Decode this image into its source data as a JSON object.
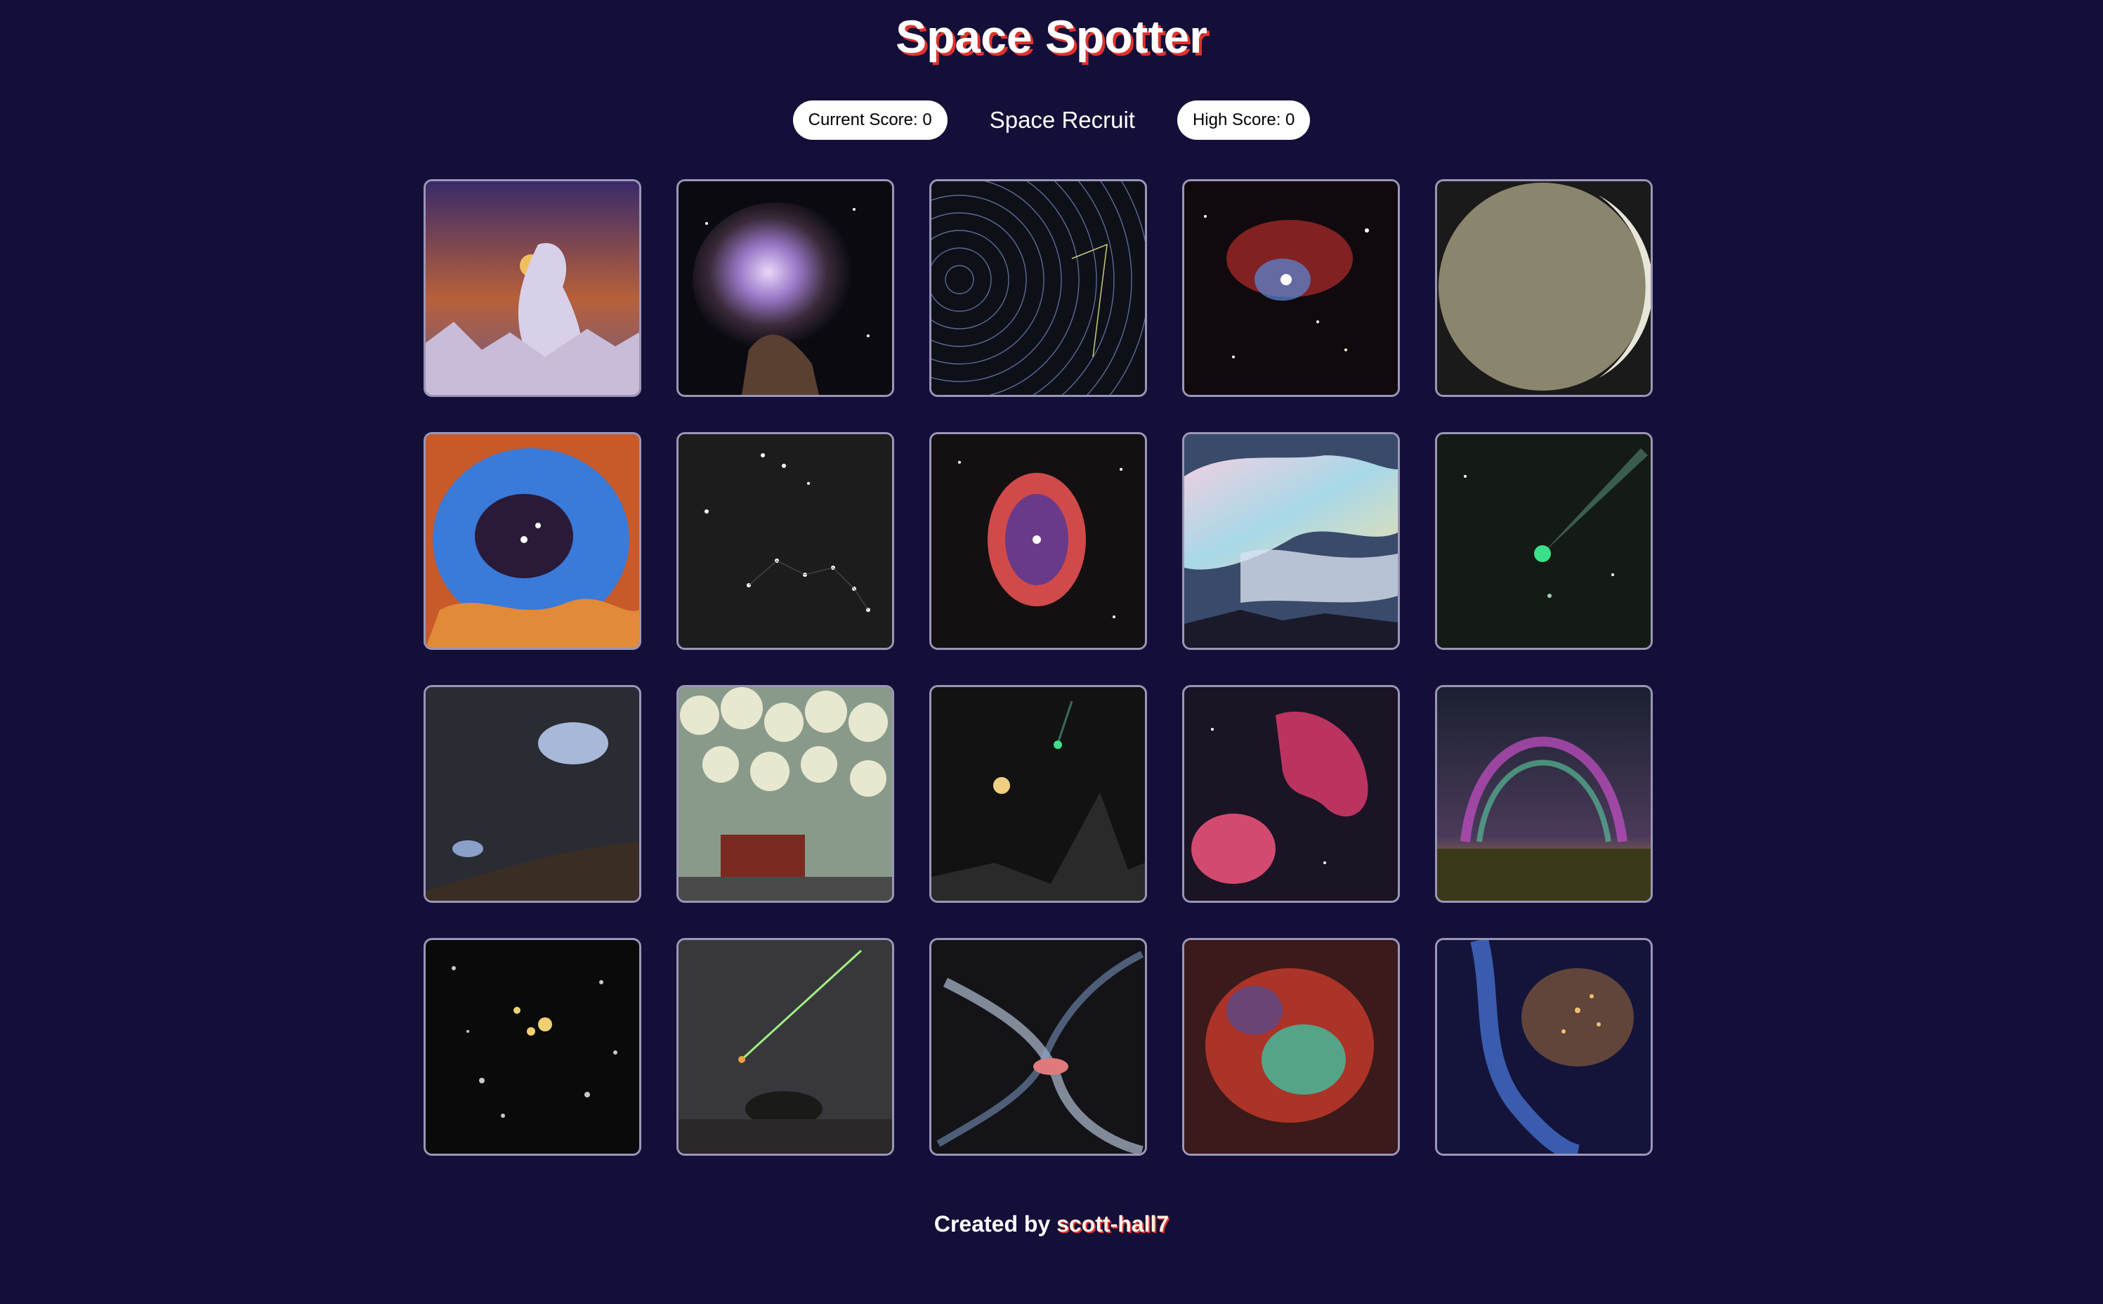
{
  "header": {
    "title": "Space Spotter"
  },
  "scoreboard": {
    "current_score": "Current Score: 0",
    "rank": "Space Recruit",
    "high_score": "High Score: 0"
  },
  "cards": [
    {
      "icon": "alien-rock-landscape-image",
      "palette": [
        "#4a2c6e",
        "#e48a3c",
        "#d9d2e8"
      ]
    },
    {
      "icon": "orion-nebula-image",
      "palette": [
        "#0d0d14",
        "#c9b7e6",
        "#8a5a3c"
      ]
    },
    {
      "icon": "star-trails-image",
      "palette": [
        "#101218",
        "#6b7fa8",
        "#c8cc7a"
      ]
    },
    {
      "icon": "red-nebula-starfield-image",
      "palette": [
        "#120c10",
        "#d0403a",
        "#e8f0ff"
      ]
    },
    {
      "icon": "moon-enceladus-image",
      "palette": [
        "#1a1a1a",
        "#8a8672",
        "#d8d6c8"
      ]
    },
    {
      "icon": "rosette-nebula-image",
      "palette": [
        "#2a4a8a",
        "#e06a2a",
        "#4fa8e8"
      ]
    },
    {
      "icon": "big-dipper-little-dipper-image",
      "palette": [
        "#1c1c1c",
        "#ffffff",
        "#8a8a8a"
      ]
    },
    {
      "icon": "red-shell-nebula-image",
      "palette": [
        "#151012",
        "#e04a4a",
        "#8a3cb0"
      ]
    },
    {
      "icon": "nacreous-clouds-image",
      "palette": [
        "#3a4a6a",
        "#e8c8d8",
        "#b8e0f0"
      ]
    },
    {
      "icon": "green-comet-image",
      "palette": [
        "#151a14",
        "#3ae08a",
        "#6a8a7a"
      ]
    },
    {
      "icon": "galaxies-over-hill-image",
      "palette": [
        "#2a2c34",
        "#a8b8d8",
        "#4a3a2a"
      ]
    },
    {
      "icon": "mammatus-clouds-image",
      "palette": [
        "#8a9a8a",
        "#e8e8d0",
        "#6a2a20"
      ]
    },
    {
      "icon": "comet-over-matterhorn-image",
      "palette": [
        "#141414",
        "#3ae08a",
        "#f0d080"
      ]
    },
    {
      "icon": "heart-nebula-image",
      "palette": [
        "#1a1420",
        "#e0407a",
        "#4a6a8a"
      ]
    },
    {
      "icon": "aurora-arc-image",
      "palette": [
        "#1a2030",
        "#c850c8",
        "#f0b040"
      ]
    },
    {
      "icon": "galaxy-cluster-image",
      "palette": [
        "#0a0a0a",
        "#f0d070",
        "#9a9a9a"
      ]
    },
    {
      "icon": "meteor-over-tree-image",
      "palette": [
        "#3a3a3c",
        "#a0f080",
        "#f0a040"
      ]
    },
    {
      "icon": "barred-spiral-galaxy-image",
      "palette": [
        "#141418",
        "#c8d8f0",
        "#e07a7a"
      ]
    },
    {
      "icon": "colorful-emission-nebula-image",
      "palette": [
        "#3a1a1a",
        "#40e0a0",
        "#e04a3a"
      ]
    },
    {
      "icon": "blue-star-cluster-image",
      "palette": [
        "#1a1a3a",
        "#4a7ae0",
        "#f0a040"
      ]
    }
  ],
  "footer": {
    "prefix": "Created by ",
    "author": "scott-hall7"
  }
}
